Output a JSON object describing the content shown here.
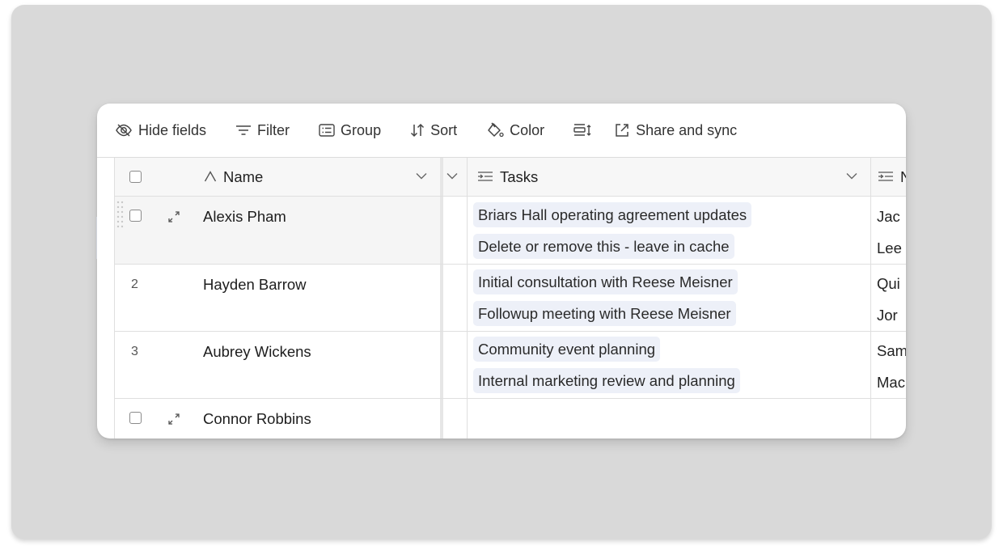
{
  "toolbar": {
    "hide_fields": "Hide fields",
    "filter": "Filter",
    "group": "Group",
    "sort": "Sort",
    "color": "Color",
    "share_and_sync": "Share and sync"
  },
  "columns": {
    "name": "Name",
    "tasks": "Tasks",
    "third_partial": "N"
  },
  "rows": [
    {
      "number": "",
      "name": "Alexis Pham",
      "tasks": [
        "Briars Hall operating agreement updates",
        "Delete or remove this - leave in cache"
      ],
      "third": [
        "Jac",
        "Lee"
      ]
    },
    {
      "number": "2",
      "name": "Hayden Barrow",
      "tasks": [
        "Initial consultation with Reese Meisner",
        "Followup meeting with Reese Meisner"
      ],
      "third": [
        "Qui",
        "Jor"
      ]
    },
    {
      "number": "3",
      "name": "Aubrey Wickens",
      "tasks": [
        "Community event planning",
        "Internal marketing review and planning"
      ],
      "third": [
        "Sam",
        "Mac"
      ]
    },
    {
      "number": "",
      "name": "Connor Robbins",
      "tasks": [],
      "third": []
    }
  ],
  "colors": {
    "backdrop": "#d9d9d9",
    "chip_bg": "#edf0f8",
    "header_bg": "#f7f7f7"
  }
}
